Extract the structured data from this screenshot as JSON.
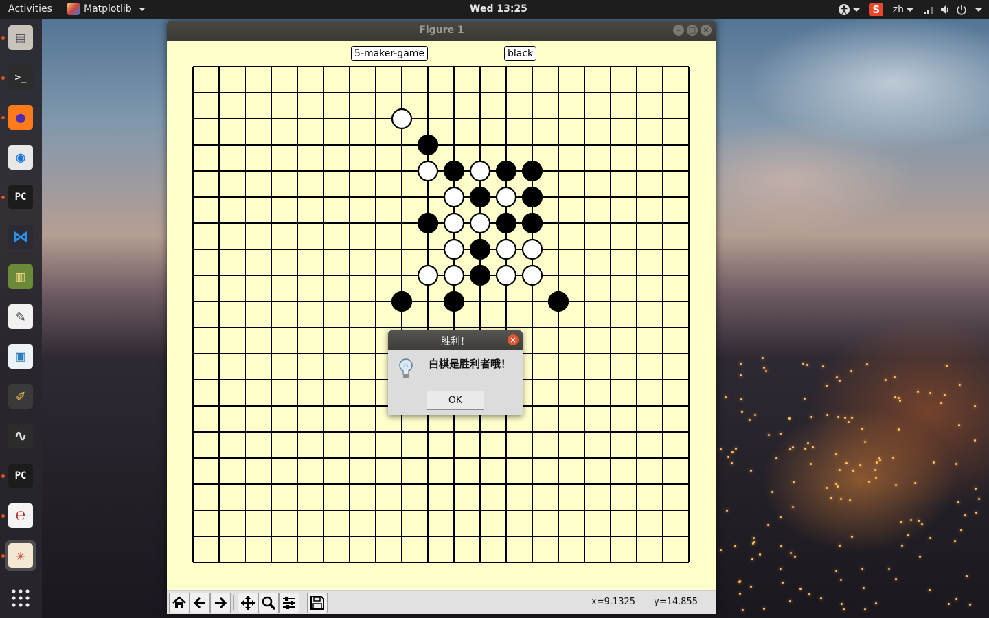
{
  "topbar": {
    "activities": "Activities",
    "app_name": "Matplotlib",
    "clock": "Wed 13:25",
    "input_method": "zh"
  },
  "dock": {
    "items": [
      {
        "name": "files",
        "icon": "file-cabinet-icon",
        "running": true
      },
      {
        "name": "terminal",
        "icon": "terminal-icon",
        "running": true
      },
      {
        "name": "firefox",
        "icon": "firefox-icon",
        "running": true
      },
      {
        "name": "chrome",
        "icon": "chrome-icon",
        "running": false
      },
      {
        "name": "pycharm",
        "icon": "pycharm-icon",
        "running": true
      },
      {
        "name": "vscode",
        "icon": "vscode-icon",
        "running": false
      },
      {
        "name": "books",
        "icon": "books-icon",
        "running": false
      },
      {
        "name": "text-editor",
        "icon": "text-editor-icon",
        "running": false
      },
      {
        "name": "image-viewer",
        "icon": "image-viewer-icon",
        "running": false
      },
      {
        "name": "paint",
        "icon": "paint-brush-icon",
        "running": false
      },
      {
        "name": "system-monitor",
        "icon": "system-monitor-icon",
        "running": false
      },
      {
        "name": "pycharm-2",
        "icon": "pycharm-icon",
        "running": true
      },
      {
        "name": "document-viewer",
        "icon": "document-viewer-icon",
        "running": true
      },
      {
        "name": "matplotlib",
        "icon": "matplotlib-icon",
        "running": true,
        "active": true
      }
    ],
    "show_apps_icon": "grid-icon"
  },
  "window": {
    "title": "Figure 1"
  },
  "figure": {
    "title_box": "5-maker-game",
    "turn_box": "black",
    "board_size": 19,
    "background_color": "#ffffcc",
    "stones": [
      {
        "col": 8,
        "row": 2,
        "color": "white"
      },
      {
        "col": 9,
        "row": 3,
        "color": "black"
      },
      {
        "col": 9,
        "row": 4,
        "color": "white"
      },
      {
        "col": 10,
        "row": 4,
        "color": "black"
      },
      {
        "col": 11,
        "row": 4,
        "color": "white"
      },
      {
        "col": 12,
        "row": 4,
        "color": "black"
      },
      {
        "col": 13,
        "row": 4,
        "color": "black"
      },
      {
        "col": 10,
        "row": 5,
        "color": "white"
      },
      {
        "col": 11,
        "row": 5,
        "color": "black"
      },
      {
        "col": 12,
        "row": 5,
        "color": "white"
      },
      {
        "col": 13,
        "row": 5,
        "color": "black"
      },
      {
        "col": 9,
        "row": 6,
        "color": "black"
      },
      {
        "col": 10,
        "row": 6,
        "color": "white"
      },
      {
        "col": 11,
        "row": 6,
        "color": "white"
      },
      {
        "col": 12,
        "row": 6,
        "color": "black"
      },
      {
        "col": 13,
        "row": 6,
        "color": "black"
      },
      {
        "col": 10,
        "row": 7,
        "color": "white"
      },
      {
        "col": 11,
        "row": 7,
        "color": "black"
      },
      {
        "col": 12,
        "row": 7,
        "color": "white"
      },
      {
        "col": 13,
        "row": 7,
        "color": "white"
      },
      {
        "col": 9,
        "row": 8,
        "color": "white"
      },
      {
        "col": 10,
        "row": 8,
        "color": "white"
      },
      {
        "col": 11,
        "row": 8,
        "color": "black"
      },
      {
        "col": 12,
        "row": 8,
        "color": "white"
      },
      {
        "col": 13,
        "row": 8,
        "color": "white"
      },
      {
        "col": 8,
        "row": 9,
        "color": "black"
      },
      {
        "col": 10,
        "row": 9,
        "color": "black"
      },
      {
        "col": 14,
        "row": 9,
        "color": "black"
      }
    ]
  },
  "toolbar": {
    "buttons": [
      {
        "name": "home-button",
        "icon": "home-icon"
      },
      {
        "name": "back-button",
        "icon": "arrow-left-icon"
      },
      {
        "name": "forward-button",
        "icon": "arrow-right-icon"
      },
      {
        "name": "pan-button",
        "icon": "move-icon"
      },
      {
        "name": "zoom-button",
        "icon": "magnifier-icon"
      },
      {
        "name": "configure-subplots-button",
        "icon": "sliders-icon"
      },
      {
        "name": "save-button",
        "icon": "floppy-disk-icon"
      }
    ],
    "x_readout": "x=9.1325",
    "y_readout": "y=14.855"
  },
  "dialog": {
    "title": "胜利！",
    "message": "白棋是胜利者哦！",
    "ok_label": "OK",
    "icon": "lightbulb-icon"
  }
}
